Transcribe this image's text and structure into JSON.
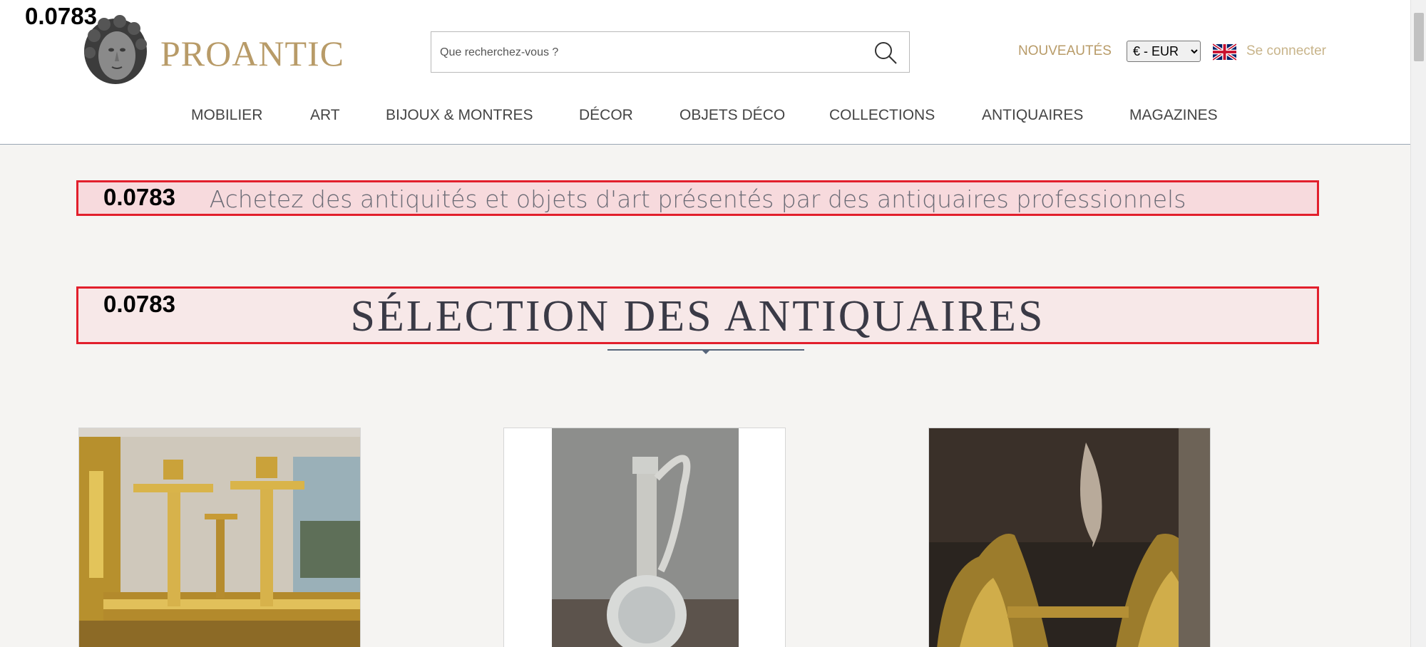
{
  "score_top_left": "0.0783",
  "logo": {
    "text": "PROANTIC",
    "icon": "sculpted-head-logo"
  },
  "search": {
    "placeholder": "Que recherchez-vous ?",
    "icon": "search-icon"
  },
  "header_links": {
    "new": "NOUVEAUTÉS",
    "currency_selected": "€ - EUR",
    "language_flag": "uk-flag-icon",
    "login": "Se connecter"
  },
  "nav": {
    "items": [
      "MOBILIER",
      "ART",
      "BIJOUX & MONTRES",
      "DÉCOR",
      "OBJETS DÉCO",
      "COLLECTIONS",
      "ANTIQUAIRES",
      "MAGAZINES"
    ]
  },
  "banner": {
    "score": "0.0783",
    "text": "Achetez des antiquités et objets d'art présentés par des antiquaires professionnels"
  },
  "section": {
    "score": "0.0783",
    "title": "SÉLECTION DES ANTIQUAIRES"
  },
  "products": [
    {
      "image": "gilt-candlesticks-photo"
    },
    {
      "image": "silver-crystal-ewer-photo"
    },
    {
      "image": "gilt-bronze-andirons-photo"
    }
  ],
  "colors": {
    "gold": "#b89b68",
    "highlight_border": "#e21f2c",
    "banner_bg": "#f7dadd",
    "page_bg": "#f5f4f2"
  }
}
